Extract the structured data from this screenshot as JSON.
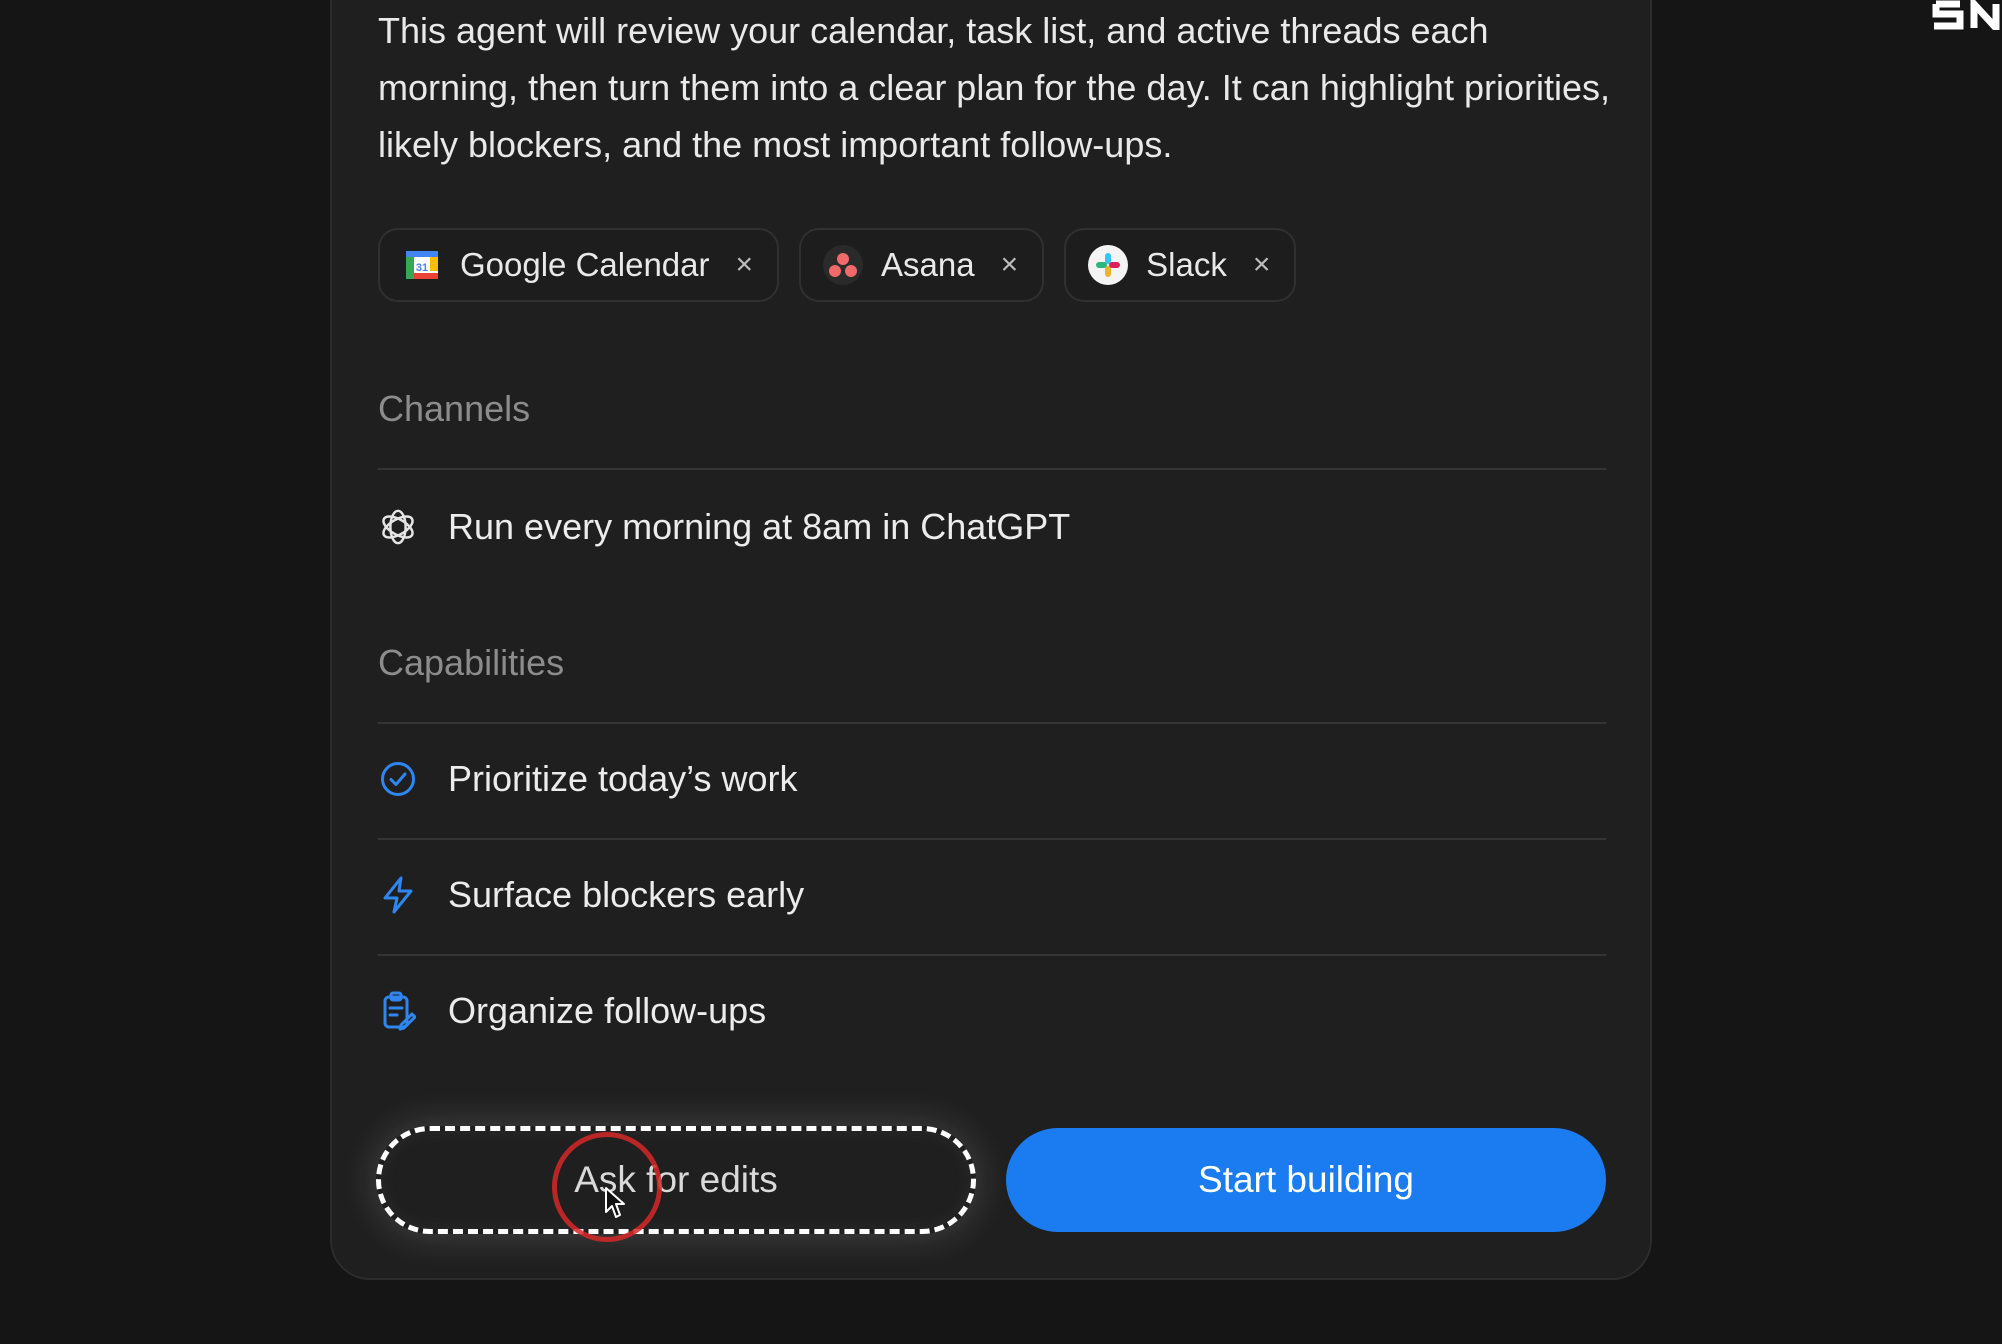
{
  "agent": {
    "description": "This agent will review your calendar, task list, and active threads each morning, then turn them into a clear plan for the day. It can highlight priorities, likely blockers, and the most important follow-ups."
  },
  "connectors": [
    {
      "label": "Google Calendar",
      "icon": "google-calendar-icon",
      "remove": "×"
    },
    {
      "label": "Asana",
      "icon": "asana-icon",
      "remove": "×"
    },
    {
      "label": "Slack",
      "icon": "slack-icon",
      "remove": "×"
    }
  ],
  "channels": {
    "title": "Channels",
    "items": [
      {
        "label": "Run every morning at 8am in ChatGPT",
        "icon": "chatgpt-icon"
      }
    ]
  },
  "capabilities": {
    "title": "Capabilities",
    "items": [
      {
        "label": "Prioritize today’s work",
        "icon": "check-circle-icon"
      },
      {
        "label": "Surface blockers early",
        "icon": "lightning-icon"
      },
      {
        "label": "Organize follow-ups",
        "icon": "clipboard-edit-icon"
      }
    ]
  },
  "actions": {
    "ask_edits_label": "Ask for edits",
    "start_building_label": "Start building"
  },
  "colors": {
    "accent": "#1a7cf0",
    "background": "#151515",
    "card": "#1f1f1f"
  }
}
